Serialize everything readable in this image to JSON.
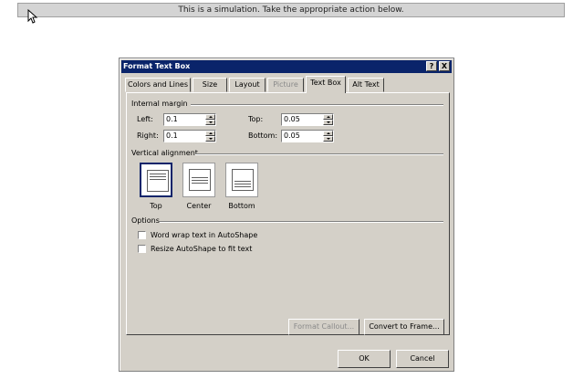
{
  "banner": {
    "text": "This is a simulation. Take the appropriate action below."
  },
  "dialog": {
    "title": "Format Text Box",
    "help_button": "?",
    "close_button": "X",
    "tabs": [
      {
        "label": "Colors and Lines"
      },
      {
        "label": "Size"
      },
      {
        "label": "Layout"
      },
      {
        "label": "Picture"
      },
      {
        "label": "Text Box"
      },
      {
        "label": "Alt Text"
      }
    ],
    "internal_margin": {
      "heading": "Internal margin",
      "left_label": "Left:",
      "left_value": "0.1",
      "right_label": "Right:",
      "right_value": "0.1",
      "top_label": "Top:",
      "top_value": "0.05",
      "bottom_label": "Bottom:",
      "bottom_value": "0.05"
    },
    "vertical_alignment": {
      "heading": "Vertical alignment",
      "options": [
        {
          "label": "Top"
        },
        {
          "label": "Center"
        },
        {
          "label": "Bottom"
        }
      ],
      "selected": "Top"
    },
    "options": {
      "heading": "Options",
      "word_wrap": "Word wrap text in AutoShape",
      "resize": "Resize AutoShape to fit text"
    },
    "format_callout_button": "Format Callout...",
    "convert_button": "Convert to Frame...",
    "ok_button": "OK",
    "cancel_button": "Cancel"
  }
}
